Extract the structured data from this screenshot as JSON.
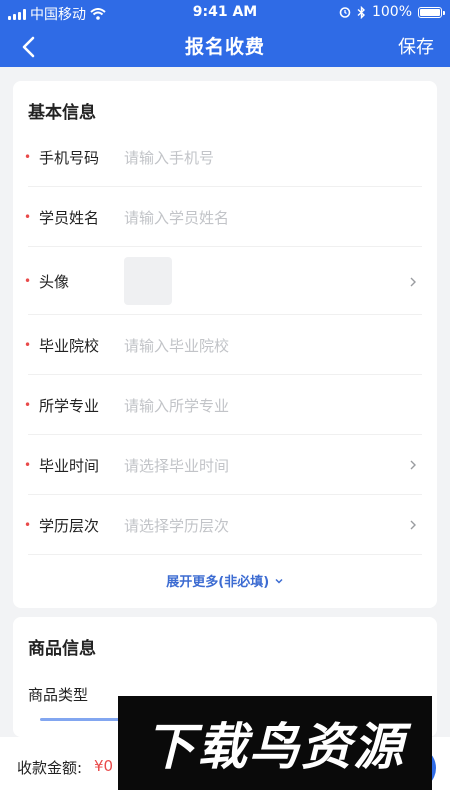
{
  "status_bar": {
    "carrier": "中国移动",
    "time": "9:41 AM",
    "battery": "100%",
    "icons": [
      "signal-icon",
      "wifi-icon",
      "alarm-icon",
      "bluetooth-icon",
      "battery-icon"
    ]
  },
  "nav": {
    "title": "报名收费",
    "save_label": "保存",
    "back_icon": "chevron-left-icon"
  },
  "basic_info": {
    "title": "基本信息",
    "fields": [
      {
        "label": "手机号码",
        "placeholder": "请输入手机号",
        "required": true
      },
      {
        "label": "学员姓名",
        "placeholder": "请输入学员姓名",
        "required": true
      },
      {
        "label": "头像",
        "placeholder": "",
        "required": true
      },
      {
        "label": "毕业院校",
        "placeholder": "请输入毕业院校",
        "required": true
      },
      {
        "label": "所学专业",
        "placeholder": "请输入所学专业",
        "required": true
      },
      {
        "label": "毕业时间",
        "placeholder": "请选择毕业时间",
        "required": true
      },
      {
        "label": "学历层次",
        "placeholder": "请选择学历层次",
        "required": true
      }
    ],
    "expand_label": "展开更多(非必填)"
  },
  "product_info": {
    "title": "商品信息",
    "type_label": "商品类型"
  },
  "footer": {
    "amount_label": "收款金额:",
    "amount_value": "¥0"
  },
  "watermark": {
    "text": "下载鸟资源"
  },
  "colors": {
    "primary": "#2f6be6",
    "required": "#e94a4a",
    "placeholder": "#c2c4c8",
    "link": "#3d6cd2",
    "background": "#f2f3f5"
  }
}
